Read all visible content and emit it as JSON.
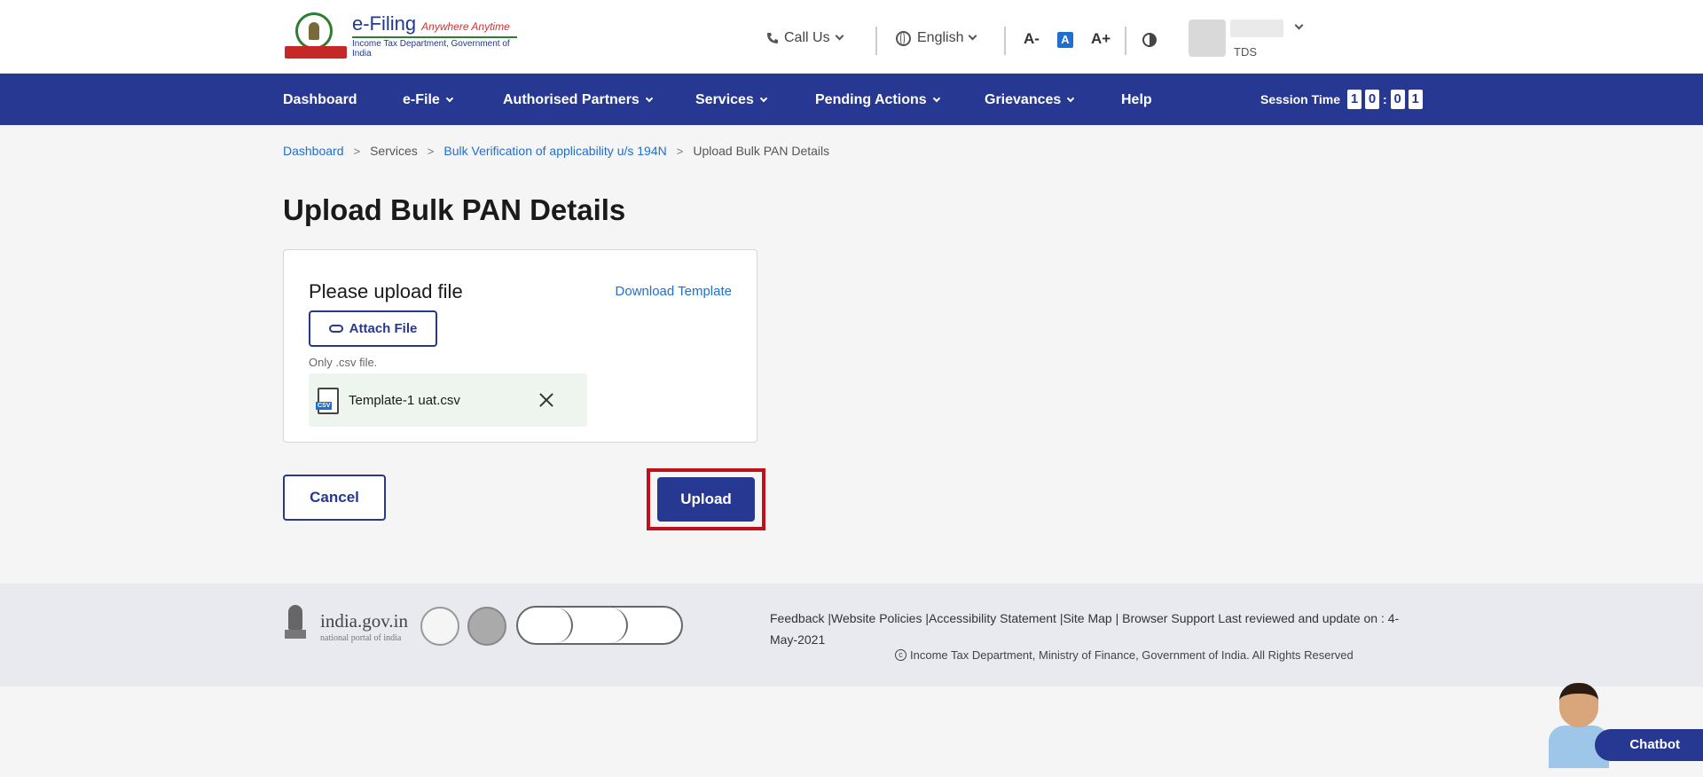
{
  "header": {
    "logo_title": "e-Filing",
    "logo_tagline": "Anywhere Anytime",
    "logo_subtitle": "Income Tax Department, Government of India",
    "call_us": "Call Us",
    "language": "English",
    "font_decrease": "A-",
    "font_normal": "A",
    "font_increase": "A+",
    "user_role": "TDS"
  },
  "nav": {
    "items": [
      {
        "label": "Dashboard"
      },
      {
        "label": "e-File"
      },
      {
        "label": "Authorised Partners"
      },
      {
        "label": "Services"
      },
      {
        "label": "Pending Actions"
      },
      {
        "label": "Grievances"
      },
      {
        "label": "Help"
      }
    ],
    "session_label": "Session Time",
    "session_digits": [
      "1",
      "0",
      "0",
      "1"
    ]
  },
  "breadcrumb": {
    "items": [
      {
        "label": "Dashboard"
      },
      {
        "label": "Services"
      },
      {
        "label": "Bulk Verification of applicability u/s 194N"
      },
      {
        "label": "Upload Bulk PAN Details"
      }
    ]
  },
  "page": {
    "title": "Upload Bulk PAN Details"
  },
  "upload_card": {
    "title": "Please upload file",
    "download_template": "Download Template",
    "attach_label": "Attach File",
    "hint": "Only .csv file.",
    "file_type_badge": "CSV",
    "file_name": "Template-1 uat.csv"
  },
  "actions": {
    "cancel": "Cancel",
    "upload": "Upload"
  },
  "footer": {
    "india_gov": "india.gov.in",
    "india_sub": "national portal of india",
    "links": "Feedback |Website Policies |Accessibility Statement |Site Map | Browser Support   Last reviewed and update on : 4-May-2021",
    "copyright": "Income Tax Department, Ministry of Finance, Government of India. All Rights Reserved"
  },
  "chatbot": {
    "label": "Chatbot"
  },
  "colors": {
    "primary": "#263891",
    "link": "#1f6fd1",
    "highlight": "#c0101a"
  }
}
